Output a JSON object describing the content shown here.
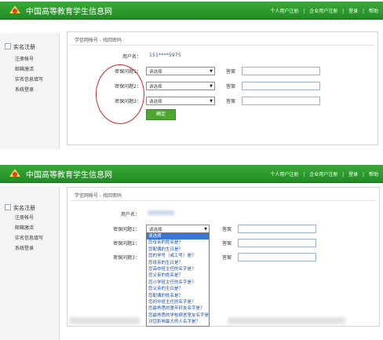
{
  "site_title": "中国高等教育学生信息网",
  "topnav": {
    "personal_register": "个人用户注册",
    "company_register": "企业用户注册",
    "login": "登录",
    "help": "帮助",
    "separator": "|"
  },
  "sidebar": {
    "heading": "实名注册",
    "items": [
      "注册帐号",
      "邮箱激活",
      "实名信息填写",
      "系统登录"
    ]
  },
  "breadcrumb": "学信网帐号 - 找回密码",
  "form": {
    "username_label": "用户名",
    "username_value": "151****5975",
    "q1_label": "密保问题1",
    "q2_label": "密保问题2",
    "q3_label": "密保问题3",
    "answer_label": "答案",
    "select_placeholder": "请选择",
    "confirm_button": "确定",
    "colon": "："
  },
  "dropdown": {
    "options": [
      "请选择",
      "您母亲的姓名是？",
      "您配偶的生日是？",
      "您的学号（或工号）是？",
      "您母亲的生日是？",
      "您高中班主任的名字是？",
      "您父亲的姓名是？",
      "您小学班主任的名字是？",
      "您父亲的生日是？",
      "您配偶的姓名是？",
      "您初中班主任的名字是？",
      "您最熟悉的童年好友名字是？",
      "您最熟悉的学校宿舍室友名字是？",
      "对您影响最大的人名字是？"
    ]
  },
  "colors": {
    "header_green": "#2b9a2d",
    "accent_blue": "#1a4fa3",
    "button_green": "#4ea52f",
    "annotation_red": "#d3282b"
  }
}
